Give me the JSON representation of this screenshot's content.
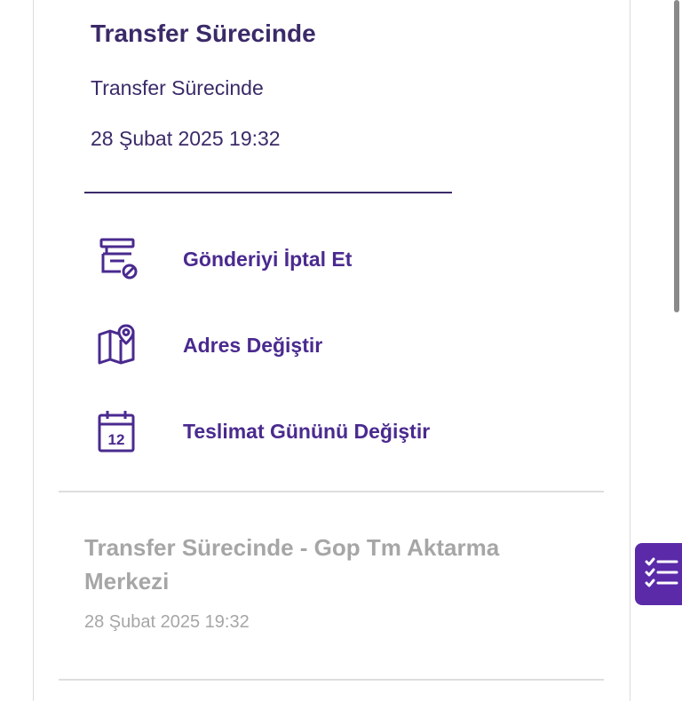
{
  "current_status": {
    "title": "Transfer Sürecinde",
    "subtitle": "Transfer Sürecinde",
    "date": "28 Şubat 2025 19:32"
  },
  "actions": [
    {
      "label": "Gönderiyi İptal Et",
      "icon": "cancel-shipment-icon"
    },
    {
      "label": "Adres Değiştir",
      "icon": "map-pin-icon"
    },
    {
      "label": "Teslimat Gününü Değiştir",
      "icon": "calendar-icon"
    }
  ],
  "history": [
    {
      "title": "Transfer Sürecinde - Gop Tm Aktarma Merkezi",
      "date": "28 Şubat 2025 19:32"
    }
  ],
  "fab": {
    "icon": "checklist-icon"
  },
  "colors": {
    "primary": "#4a2a8f",
    "title": "#3b2a68",
    "muted": "#a6a6a6",
    "fab_bg": "#5a2aa8"
  }
}
